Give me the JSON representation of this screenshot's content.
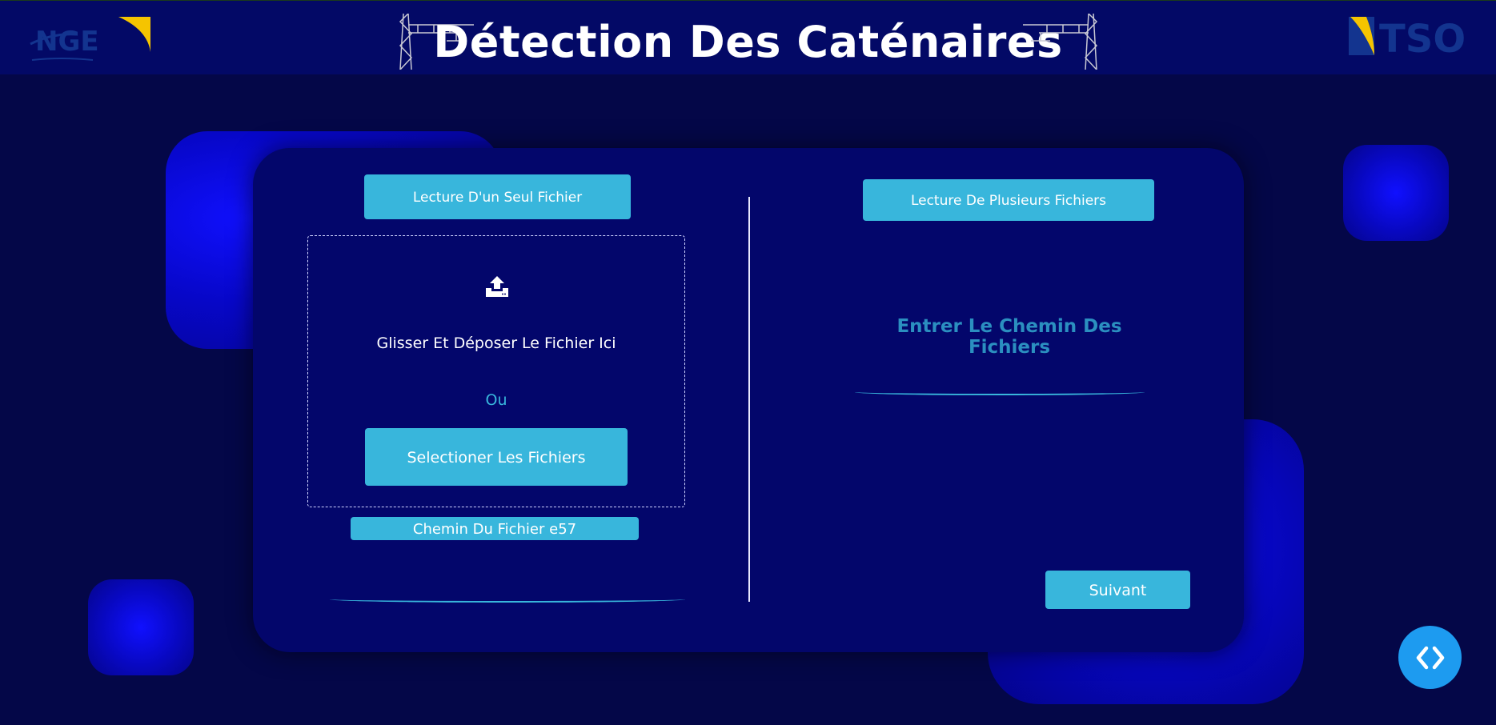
{
  "header": {
    "title": "Détection Des Caténaires",
    "logo_left": "NGE",
    "logo_right": "TSO",
    "decor_icon": "catenary-pylon-icon"
  },
  "single_file": {
    "button_label": "Lecture D'un Seul Fichier",
    "upload_icon": "upload-icon",
    "drop_text": "Glisser Et Déposer Le Fichier Ici",
    "or_text": "Ou",
    "select_label": "Selectioner Les Fichiers",
    "path_label": "Chemin Du Fichier e57"
  },
  "multi_file": {
    "button_label": "Lecture De Plusieurs Fichiers",
    "path_prompt": "Entrer Le Chemin Des Fichiers"
  },
  "next_button": "Suivant",
  "fab_icon": "code-toggle-icon",
  "colors": {
    "background": "#040748",
    "header": "#030966",
    "card": "#03066b",
    "accent": "#38b6dc",
    "prompt": "#2b8fc0",
    "fab": "#1d9bf0",
    "logo_yellow": "#f5c400"
  }
}
